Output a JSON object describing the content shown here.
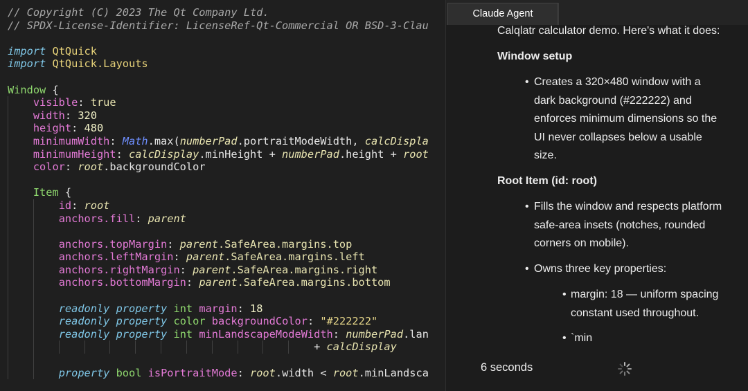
{
  "editor": {
    "lines": [
      {
        "indent": 0,
        "tokens": [
          {
            "t": "// Copyright (C) 2023 The Qt Company Ltd.",
            "c": "comment"
          }
        ]
      },
      {
        "indent": 0,
        "tokens": [
          {
            "t": "// SPDX-License-Identifier: LicenseRef-Qt-Commercial OR BSD-3-Clau",
            "c": "comment"
          }
        ]
      },
      {
        "indent": 0,
        "tokens": []
      },
      {
        "indent": 0,
        "tokens": [
          {
            "t": "import",
            "c": "keyword"
          },
          {
            "t": " "
          },
          {
            "t": "QtQuick",
            "c": "module"
          }
        ]
      },
      {
        "indent": 0,
        "tokens": [
          {
            "t": "import",
            "c": "keyword"
          },
          {
            "t": " "
          },
          {
            "t": "QtQuick.Layouts",
            "c": "module"
          }
        ]
      },
      {
        "indent": 0,
        "tokens": []
      },
      {
        "indent": 0,
        "tokens": [
          {
            "t": "Window",
            "c": "type"
          },
          {
            "t": " {",
            "c": "plain"
          }
        ]
      },
      {
        "indent": 1,
        "tokens": [
          {
            "t": "visible",
            "c": "prop"
          },
          {
            "t": ": ",
            "c": "plain"
          },
          {
            "t": "true",
            "c": "value"
          }
        ]
      },
      {
        "indent": 1,
        "tokens": [
          {
            "t": "width",
            "c": "prop"
          },
          {
            "t": ": ",
            "c": "plain"
          },
          {
            "t": "320",
            "c": "num"
          }
        ]
      },
      {
        "indent": 1,
        "tokens": [
          {
            "t": "height",
            "c": "prop"
          },
          {
            "t": ": ",
            "c": "plain"
          },
          {
            "t": "480",
            "c": "num"
          }
        ]
      },
      {
        "indent": 1,
        "tokens": [
          {
            "t": "minimumWidth",
            "c": "prop"
          },
          {
            "t": ": ",
            "c": "plain"
          },
          {
            "t": "Math",
            "c": "ns"
          },
          {
            "t": ".max(",
            "c": "plain"
          },
          {
            "t": "numberPad",
            "c": "id"
          },
          {
            "t": ".portraitModeWidth, ",
            "c": "plain"
          },
          {
            "t": "calcDispla",
            "c": "id"
          }
        ]
      },
      {
        "indent": 1,
        "tokens": [
          {
            "t": "minimumHeight",
            "c": "prop"
          },
          {
            "t": ": ",
            "c": "plain"
          },
          {
            "t": "calcDisplay",
            "c": "id"
          },
          {
            "t": ".minHeight + ",
            "c": "plain"
          },
          {
            "t": "numberPad",
            "c": "id"
          },
          {
            "t": ".height + ",
            "c": "plain"
          },
          {
            "t": "root",
            "c": "id"
          }
        ]
      },
      {
        "indent": 1,
        "tokens": [
          {
            "t": "color",
            "c": "prop"
          },
          {
            "t": ": ",
            "c": "plain"
          },
          {
            "t": "root",
            "c": "id"
          },
          {
            "t": ".backgroundColor",
            "c": "plain"
          }
        ]
      },
      {
        "indent": 1,
        "tokens": []
      },
      {
        "indent": 1,
        "tokens": [
          {
            "t": "Item",
            "c": "type"
          },
          {
            "t": " {",
            "c": "plain"
          }
        ]
      },
      {
        "indent": 2,
        "tokens": [
          {
            "t": "id",
            "c": "prop"
          },
          {
            "t": ": ",
            "c": "plain"
          },
          {
            "t": "root",
            "c": "id"
          }
        ]
      },
      {
        "indent": 2,
        "tokens": [
          {
            "t": "anchors.fill",
            "c": "prop"
          },
          {
            "t": ": ",
            "c": "plain"
          },
          {
            "t": "parent",
            "c": "id"
          }
        ]
      },
      {
        "indent": 2,
        "tokens": []
      },
      {
        "indent": 2,
        "tokens": [
          {
            "t": "anchors.topMargin",
            "c": "prop"
          },
          {
            "t": ": ",
            "c": "plain"
          },
          {
            "t": "parent",
            "c": "id"
          },
          {
            "t": ".SafeArea.margins.top",
            "c": "value"
          }
        ]
      },
      {
        "indent": 2,
        "tokens": [
          {
            "t": "anchors.leftMargin",
            "c": "prop"
          },
          {
            "t": ": ",
            "c": "plain"
          },
          {
            "t": "parent",
            "c": "id"
          },
          {
            "t": ".SafeArea.margins.left",
            "c": "value"
          }
        ]
      },
      {
        "indent": 2,
        "tokens": [
          {
            "t": "anchors.rightMargin",
            "c": "prop"
          },
          {
            "t": ": ",
            "c": "plain"
          },
          {
            "t": "parent",
            "c": "id"
          },
          {
            "t": ".SafeArea.margins.right",
            "c": "value"
          }
        ]
      },
      {
        "indent": 2,
        "tokens": [
          {
            "t": "anchors.bottomMargin",
            "c": "prop"
          },
          {
            "t": ": ",
            "c": "plain"
          },
          {
            "t": "parent",
            "c": "id"
          },
          {
            "t": ".SafeArea.margins.bottom",
            "c": "value"
          }
        ]
      },
      {
        "indent": 2,
        "tokens": []
      },
      {
        "indent": 2,
        "tokens": [
          {
            "t": "readonly",
            "c": "readonly"
          },
          {
            "t": " "
          },
          {
            "t": "property",
            "c": "readonly"
          },
          {
            "t": " "
          },
          {
            "t": "int",
            "c": "ptype"
          },
          {
            "t": " "
          },
          {
            "t": "margin",
            "c": "prop"
          },
          {
            "t": ": ",
            "c": "plain"
          },
          {
            "t": "18",
            "c": "num"
          }
        ]
      },
      {
        "indent": 2,
        "tokens": [
          {
            "t": "readonly",
            "c": "readonly"
          },
          {
            "t": " "
          },
          {
            "t": "property",
            "c": "readonly"
          },
          {
            "t": " "
          },
          {
            "t": "color",
            "c": "ptype"
          },
          {
            "t": " "
          },
          {
            "t": "backgroundColor",
            "c": "prop"
          },
          {
            "t": ": ",
            "c": "plain"
          },
          {
            "t": "\"#222222\"",
            "c": "str"
          }
        ]
      },
      {
        "indent": 2,
        "tokens": [
          {
            "t": "readonly",
            "c": "readonly"
          },
          {
            "t": " "
          },
          {
            "t": "property",
            "c": "readonly"
          },
          {
            "t": " "
          },
          {
            "t": "int",
            "c": "ptype"
          },
          {
            "t": " "
          },
          {
            "t": "minLandscapeModeWidth",
            "c": "prop"
          },
          {
            "t": ": ",
            "c": "plain"
          },
          {
            "t": "numberPad",
            "c": "id"
          },
          {
            "t": ".lan",
            "c": "plain"
          }
        ]
      },
      {
        "indent": 12,
        "tokens": [
          {
            "t": "+ ",
            "c": "plain"
          },
          {
            "t": "calcDisplay",
            "c": "id"
          }
        ]
      },
      {
        "indent": 2,
        "tokens": []
      },
      {
        "indent": 2,
        "tokens": [
          {
            "t": "property",
            "c": "readonly"
          },
          {
            "t": " "
          },
          {
            "t": "bool",
            "c": "ptype"
          },
          {
            "t": " "
          },
          {
            "t": "isPortraitMode",
            "c": "prop"
          },
          {
            "t": ": ",
            "c": "plain"
          },
          {
            "t": "root",
            "c": "id"
          },
          {
            "t": ".width < ",
            "c": "plain"
          },
          {
            "t": "root",
            "c": "id"
          },
          {
            "t": ".minLandsca",
            "c": "plain"
          }
        ]
      }
    ]
  },
  "agent": {
    "tab_title": "Claude Agent",
    "intro": "Calqlatr calculator demo. Here's what it does:",
    "section1_title": "Window setup",
    "section1_bullet": [
      "Creates a 320×480 window with a",
      "dark background (#222222) and",
      "enforces minimum dimensions so the",
      "UI never collapses below a usable",
      "size."
    ],
    "section2_title": "Root Item (id: root)",
    "section2_bullet1": [
      "Fills the window and respects platform",
      "safe-area insets (notches, rounded",
      "corners on mobile)."
    ],
    "section2_bullet2": "Owns three key properties:",
    "sub_bullet1": [
      "margin: 18 — uniform spacing",
      "constant used throughout."
    ],
    "sub_bullet2": "`min",
    "bullet_char": "•",
    "status_text": "6 seconds",
    "spinner_icon": "loading-spinner-icon"
  }
}
